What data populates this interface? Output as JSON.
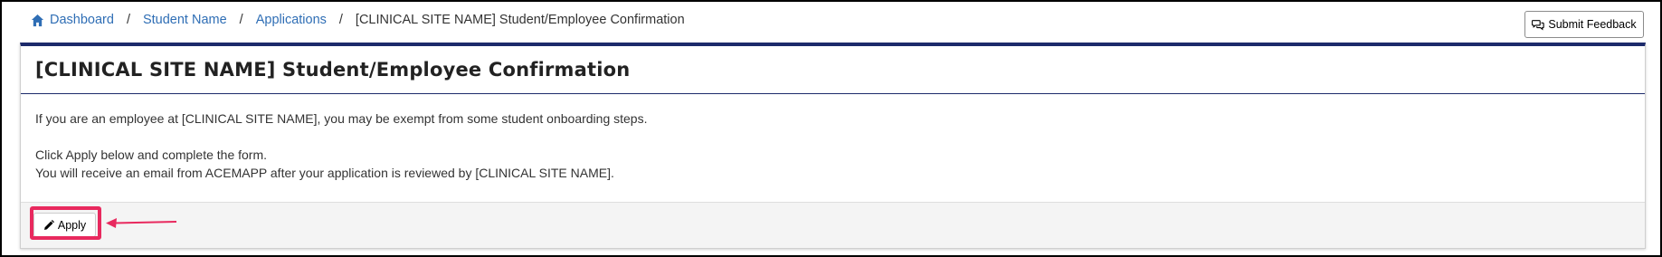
{
  "breadcrumb": {
    "home": "Dashboard",
    "student": "Student Name",
    "applications": "Applications",
    "current": "[CLINICAL SITE NAME] Student/Employee Confirmation",
    "separator": "/"
  },
  "feedback": {
    "label": "Submit Feedback"
  },
  "panel": {
    "title": "[CLINICAL SITE NAME] Student/Employee Confirmation",
    "paragraph1": "If you are an employee at [CLINICAL SITE NAME], you may be exempt from some student onboarding steps.",
    "paragraph2_line1": "Click Apply below and complete the form.",
    "paragraph2_line2": "You will receive an email from ACEMAPP after your application is reviewed by [CLINICAL SITE NAME]."
  },
  "footer": {
    "apply_label": "Apply"
  },
  "colors": {
    "link": "#2f6eb5",
    "panel_accent": "#1c2a6b",
    "annotation": "#e8295e"
  },
  "icons": {
    "home": "home-icon",
    "feedback": "chat-bubbles-icon",
    "apply": "pencil-icon"
  }
}
